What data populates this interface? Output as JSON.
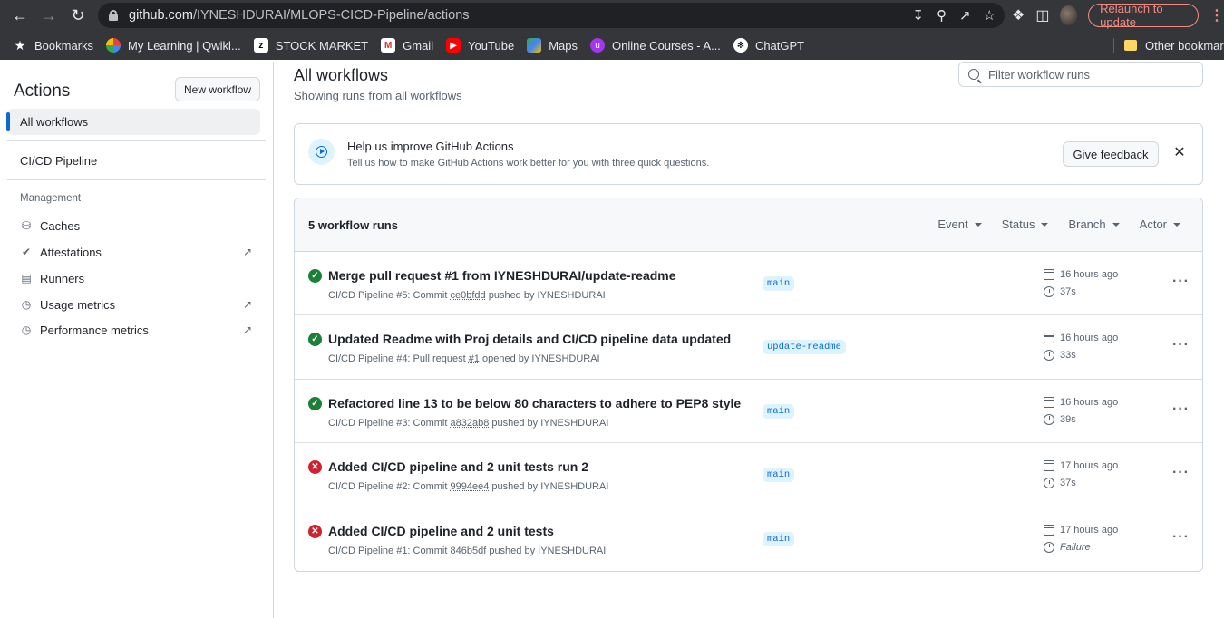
{
  "browser": {
    "url_host": "github.com",
    "url_path": "/IYNESHDURAI/MLOPS-CICD-Pipeline/actions",
    "relaunch_label": "Relaunch to update",
    "bookmarks": [
      {
        "label": "Bookmarks",
        "icon": "star-icon"
      },
      {
        "label": "My Learning | Qwikl...",
        "icon": "google-cloud-icon"
      },
      {
        "label": "STOCK MARKET",
        "icon": "stock-icon"
      },
      {
        "label": "Gmail",
        "icon": "gmail-icon"
      },
      {
        "label": "YouTube",
        "icon": "youtube-icon"
      },
      {
        "label": "Maps",
        "icon": "maps-icon"
      },
      {
        "label": "Online Courses - A...",
        "icon": "udemy-icon"
      },
      {
        "label": "ChatGPT",
        "icon": "chatgpt-icon"
      }
    ],
    "other_bookmarks": "Other bookmarks"
  },
  "sidebar": {
    "title": "Actions",
    "new_workflow": "New workflow",
    "all_workflows": "All workflows",
    "pipeline": "CI/CD Pipeline",
    "management_heading": "Management",
    "links": [
      {
        "label": "Caches",
        "icon": "database-icon",
        "external": false
      },
      {
        "label": "Attestations",
        "icon": "verified-icon",
        "external": true
      },
      {
        "label": "Runners",
        "icon": "server-icon",
        "external": false
      },
      {
        "label": "Usage metrics",
        "icon": "graph-icon",
        "external": true
      },
      {
        "label": "Performance metrics",
        "icon": "graph-icon",
        "external": true
      }
    ]
  },
  "main": {
    "title": "All workflows",
    "subtitle": "Showing runs from all workflows",
    "filter_placeholder": "Filter workflow runs",
    "feedback": {
      "title": "Help us improve GitHub Actions",
      "subtitle": "Tell us how to make GitHub Actions work better for you with three quick questions.",
      "button": "Give feedback"
    },
    "runs_count": "5 workflow runs",
    "filters": [
      "Event",
      "Status",
      "Branch",
      "Actor"
    ],
    "runs": [
      {
        "status": "success",
        "title": "Merge pull request #1 from IYNESHDURAI/update-readme",
        "meta_prefix": "CI/CD Pipeline #5: Commit ",
        "meta_ref": "ce0bfdd",
        "meta_suffix": " pushed by IYNESHDURAI",
        "branch": "main",
        "time": "16 hours ago",
        "duration": "37s"
      },
      {
        "status": "success",
        "title": "Updated Readme with Proj details and CI/CD pipeline data updated",
        "meta_prefix": "CI/CD Pipeline #4: Pull request ",
        "meta_ref": "#1",
        "meta_suffix": " opened by IYNESHDURAI",
        "branch": "update-readme",
        "time": "16 hours ago",
        "duration": "33s"
      },
      {
        "status": "success",
        "title": "Refactored line 13 to be below 80 characters to adhere to PEP8 style",
        "meta_prefix": "CI/CD Pipeline #3: Commit ",
        "meta_ref": "a832ab8",
        "meta_suffix": " pushed by IYNESHDURAI",
        "branch": "main",
        "time": "16 hours ago",
        "duration": "39s"
      },
      {
        "status": "failure",
        "title": "Added CI/CD pipeline and 2 unit tests run 2",
        "meta_prefix": "CI/CD Pipeline #2: Commit ",
        "meta_ref": "9994ee4",
        "meta_suffix": " pushed by IYNESHDURAI",
        "branch": "main",
        "time": "17 hours ago",
        "duration": "37s"
      },
      {
        "status": "failure",
        "title": "Added CI/CD pipeline and 2 unit tests",
        "meta_prefix": "CI/CD Pipeline #1: Commit ",
        "meta_ref": "846b5df",
        "meta_suffix": " pushed by IYNESHDURAI",
        "branch": "main",
        "time": "17 hours ago",
        "duration": "Failure"
      }
    ]
  },
  "colors": {
    "accent": "#0969da",
    "success": "#1a7f37",
    "failure": "#cf222e",
    "chrome": "#35363a"
  }
}
